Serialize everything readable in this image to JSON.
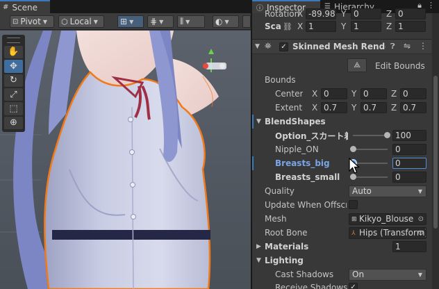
{
  "scene": {
    "tab_label": "Scene",
    "toolbar": {
      "pivot_label": "Pivot",
      "local_label": "Local"
    },
    "tools": [
      "hand-icon",
      "move-icon",
      "rotate-icon",
      "scale-icon",
      "rect-icon",
      "transform-icon"
    ]
  },
  "inspector": {
    "tabs": [
      "Inspector",
      "Hierarchy"
    ],
    "transform": {
      "rotation_label": "Rotation",
      "rotation_x": "-89.98",
      "rotation_y": "0",
      "rotation_z": "0",
      "scale_label": "Sca",
      "scale_x": "1",
      "scale_y": "1",
      "scale_z": "1"
    },
    "component": {
      "title": "Skinned Mesh Renderer",
      "enabled": true,
      "edit_bounds_label": "Edit Bounds",
      "bounds_label": "Bounds",
      "center_label": "Center",
      "center_x": "0",
      "center_y": "0",
      "center_z": "0",
      "extent_label": "Extent",
      "extent_x": "0.7",
      "extent_y": "0.7",
      "extent_z": "0.7",
      "blendshapes_label": "BlendShapes",
      "blendshapes": [
        {
          "name": "Option_スカート着",
          "value": "100",
          "fraction": 1.0
        },
        {
          "name": "Nipple_ON",
          "value": "0",
          "fraction": 0.0
        },
        {
          "name": "Breasts_big",
          "value": "0",
          "fraction": 0.0
        },
        {
          "name": "Breasts_small",
          "value": "0",
          "fraction": 0.0
        }
      ],
      "quality_label": "Quality",
      "quality_value": "Auto",
      "update_offscreen_label": "Update When Offscreen",
      "mesh_label": "Mesh",
      "mesh_value": "Kikyo_Blouse",
      "root_bone_label": "Root Bone",
      "root_bone_value": "Hips (Transform)",
      "materials_label": "Materials",
      "materials_count": "1",
      "lighting_label": "Lighting",
      "cast_shadows_label": "Cast Shadows",
      "cast_shadows_value": "On",
      "receive_shadows_label": "Receive Shadows"
    },
    "axes": {
      "x": "X",
      "y": "Y",
      "z": "Z"
    }
  },
  "colors": {
    "accent": "#3a79bb",
    "selected_outline": "#f07a1a",
    "highlight_text": "#7aa5e6"
  }
}
